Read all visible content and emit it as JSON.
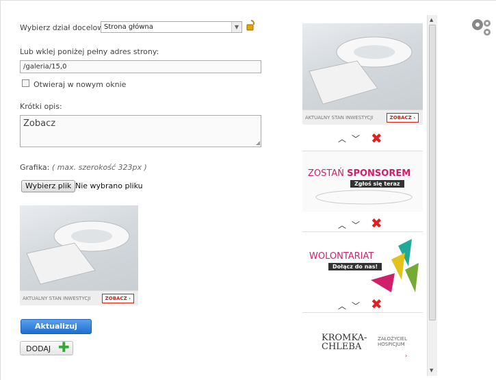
{
  "form": {
    "section_label": "Wybierz dział docelowy:",
    "section_value": "Strona główna",
    "url_label": "Lub wklej poniżej pełny adres strony:",
    "url_value": "/galeria/15,0",
    "new_window_label": "Otwieraj w nowym oknie",
    "desc_label": "Krótki opis:",
    "desc_value": "Zobacz",
    "image_label": "Grafika:",
    "image_hint": "( max. szerokość 323px )",
    "file_button": "Wybierz plik",
    "file_status": "Nie wybrano pliku",
    "preview_caption": "AKTUALNY STAN INWESTYCJI",
    "preview_button": "ZOBACZ",
    "update_button": "Aktualizuj",
    "add_button": "DODAJ"
  },
  "list": {
    "items": [
      {
        "type": "building",
        "caption": "AKTUALNY STAN INWESTYCJI",
        "button": "ZOBACZ"
      },
      {
        "type": "sponsor",
        "title_a": "ZOSTAŃ ",
        "title_b": "SPONSOREM",
        "sub": "Zgłoś się teraz"
      },
      {
        "type": "volunteer",
        "title": "WOLONTARIAT",
        "sub": "Dołącz do nas!"
      },
      {
        "type": "kromka",
        "logo": "KROMKA-CHLEBA",
        "side_text": "ZAŁOŻYCIEL HOSPICJUM"
      }
    ]
  },
  "icons": {
    "lock": "padlock-open-icon",
    "gears": "gears-icon",
    "up": "^",
    "down": "v",
    "delete": "✖",
    "plus": "+"
  },
  "colors": {
    "accent_blue": "#1f6fd0",
    "delete_red": "#d22",
    "pink": "#d0206a"
  }
}
